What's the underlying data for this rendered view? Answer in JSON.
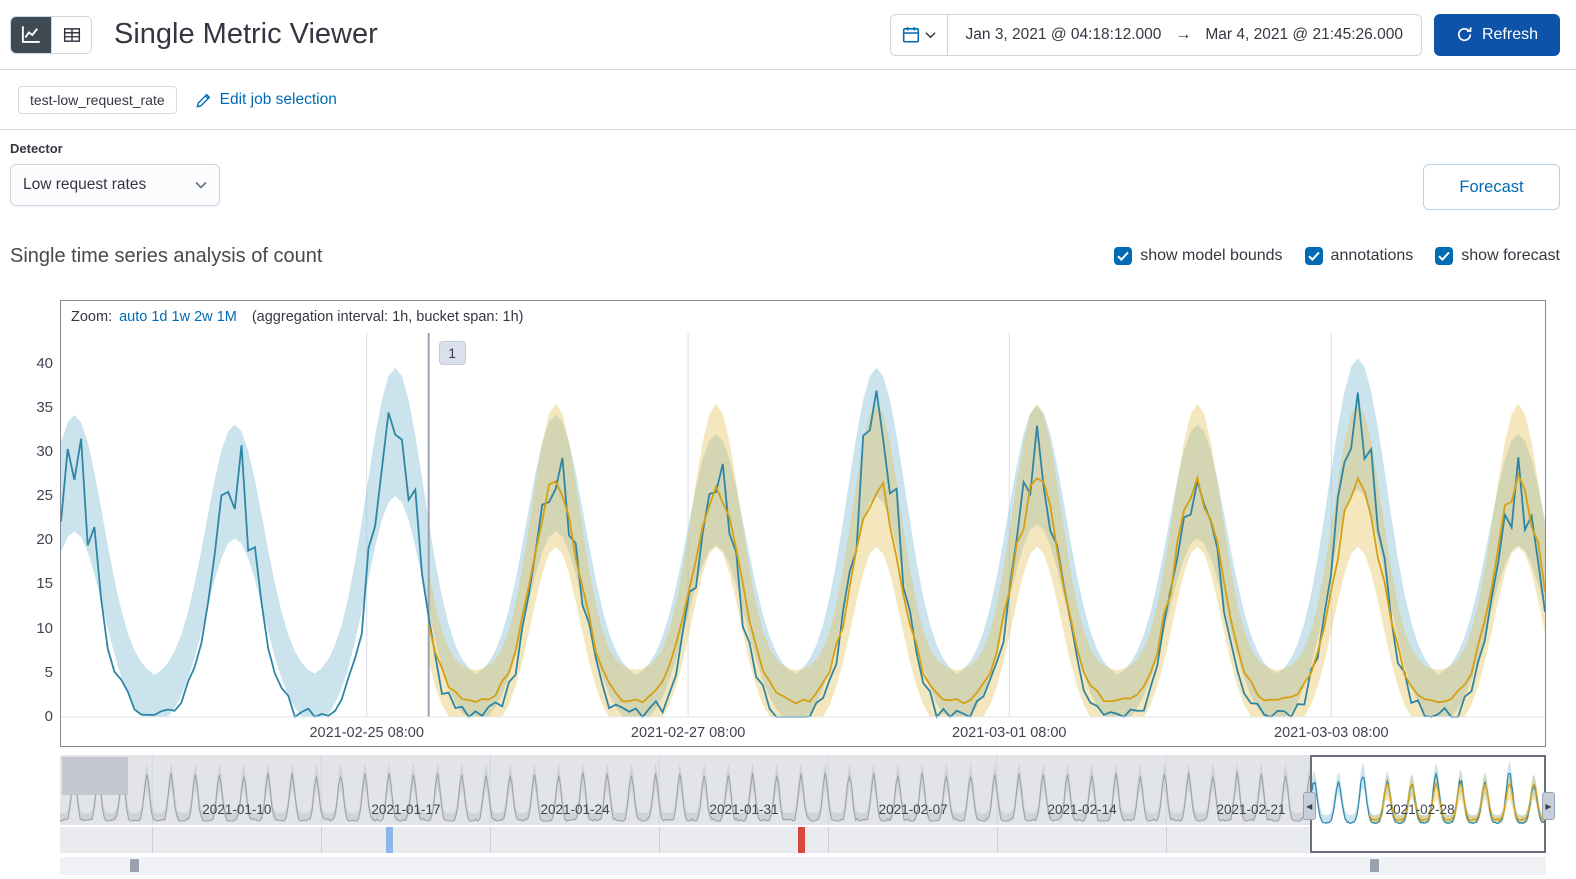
{
  "header": {
    "title": "Single Metric Viewer",
    "date_picker": {
      "start": "Jan 3, 2021 @ 04:18:12.000",
      "arrow": "→",
      "end": "Mar 4, 2021 @ 21:45:26.000"
    },
    "refresh_label": "Refresh"
  },
  "job_bar": {
    "job_badge": "test-low_request_rate",
    "edit_link": "Edit job selection"
  },
  "detector": {
    "label": "Detector",
    "selected": "Low request rates"
  },
  "forecast_button": "Forecast",
  "series_section": {
    "heading": "Single time series analysis of count",
    "checkboxes": [
      {
        "label": "show model bounds",
        "checked": true
      },
      {
        "label": "annotations",
        "checked": true
      },
      {
        "label": "show forecast",
        "checked": true
      }
    ]
  },
  "chart_data": {
    "main": {
      "type": "line",
      "zoom_label": "Zoom:",
      "zoom_options": [
        "auto",
        "1d",
        "1w",
        "2w",
        "1M"
      ],
      "zoom_suffix": "(aggregation interval: 1h, bucket span: 1h)",
      "y_ticks": [
        0,
        5,
        10,
        15,
        20,
        25,
        30,
        35,
        40
      ],
      "y_max": 43,
      "hours": 222,
      "period_hours": 24,
      "peak_hour_offset": 2,
      "forecast_start_hour": 55,
      "daily_peak_values": [
        28,
        27,
        33,
        28,
        26,
        33,
        29,
        27,
        34,
        26
      ],
      "x_ticks": [
        {
          "label": "2021-02-25 08:00",
          "f": 0.206
        },
        {
          "label": "2021-02-27 08:00",
          "f": 0.4226
        },
        {
          "label": "2021-03-01 08:00",
          "f": 0.639
        },
        {
          "label": "2021-03-03 08:00",
          "f": 0.856
        }
      ],
      "annotation": {
        "label": "1",
        "f": 0.2477
      },
      "series": [
        {
          "name": "actual",
          "color": "#2e86a5"
        },
        {
          "name": "model bounds",
          "color": "#8cc0d8"
        },
        {
          "name": "forecast",
          "color": "#d6a013"
        },
        {
          "name": "forecast bounds",
          "color": "#e3c054"
        }
      ]
    },
    "context": {
      "hours": 1473,
      "x_ticks": [
        {
          "label": "2021-01-10",
          "f": 0.119
        },
        {
          "label": "2021-01-17",
          "f": 0.2328
        },
        {
          "label": "2021-01-24",
          "f": 0.3466
        },
        {
          "label": "2021-01-31",
          "f": 0.4603
        },
        {
          "label": "2021-02-07",
          "f": 0.5741
        },
        {
          "label": "2021-02-14",
          "f": 0.6878
        },
        {
          "label": "2021-02-21",
          "f": 0.8015
        },
        {
          "label": "2021-02-28",
          "f": 0.9153
        }
      ],
      "selection": {
        "start_f": 0.841,
        "end_f": 1.0
      },
      "swimlane_markers": [
        {
          "severity": "low",
          "color": "#8ab8e8",
          "f": 0.2195
        },
        {
          "severity": "critical",
          "color": "#da453c",
          "f": 0.4966
        }
      ],
      "annotation_markers": [
        {
          "f": 0.047
        },
        {
          "f": 0.8815
        }
      ],
      "colors": {
        "line": "#9aa0a8",
        "bounds": "#c6c9cf",
        "mask_block": "#c4c7cd"
      }
    }
  }
}
